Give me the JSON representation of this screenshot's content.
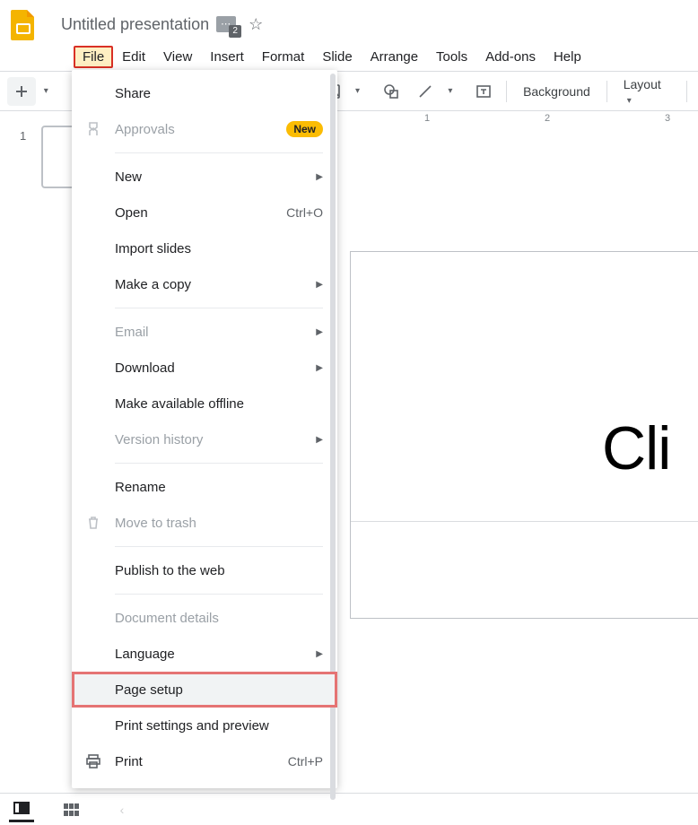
{
  "doc": {
    "title": "Untitled presentation",
    "title_badge_count": "2"
  },
  "menubar": [
    "File",
    "Edit",
    "View",
    "Insert",
    "Format",
    "Slide",
    "Arrange",
    "Tools",
    "Add-ons",
    "Help"
  ],
  "toolbar": {
    "background_label": "Background",
    "layout_label": "Layout"
  },
  "ruler": {
    "labels": [
      "1",
      "2",
      "3"
    ]
  },
  "thumbnails": {
    "first_number": "1"
  },
  "canvas": {
    "title_placeholder": "Cli"
  },
  "file_menu": {
    "share": "Share",
    "approvals": "Approvals",
    "approvals_badge": "New",
    "new": "New",
    "open": "Open",
    "open_shortcut": "Ctrl+O",
    "import_slides": "Import slides",
    "make_copy": "Make a copy",
    "email": "Email",
    "download": "Download",
    "available_offline": "Make available offline",
    "version_history": "Version history",
    "rename": "Rename",
    "move_to_trash": "Move to trash",
    "publish_web": "Publish to the web",
    "doc_details": "Document details",
    "language": "Language",
    "page_setup": "Page setup",
    "print_settings": "Print settings and preview",
    "print": "Print",
    "print_shortcut": "Ctrl+P"
  }
}
